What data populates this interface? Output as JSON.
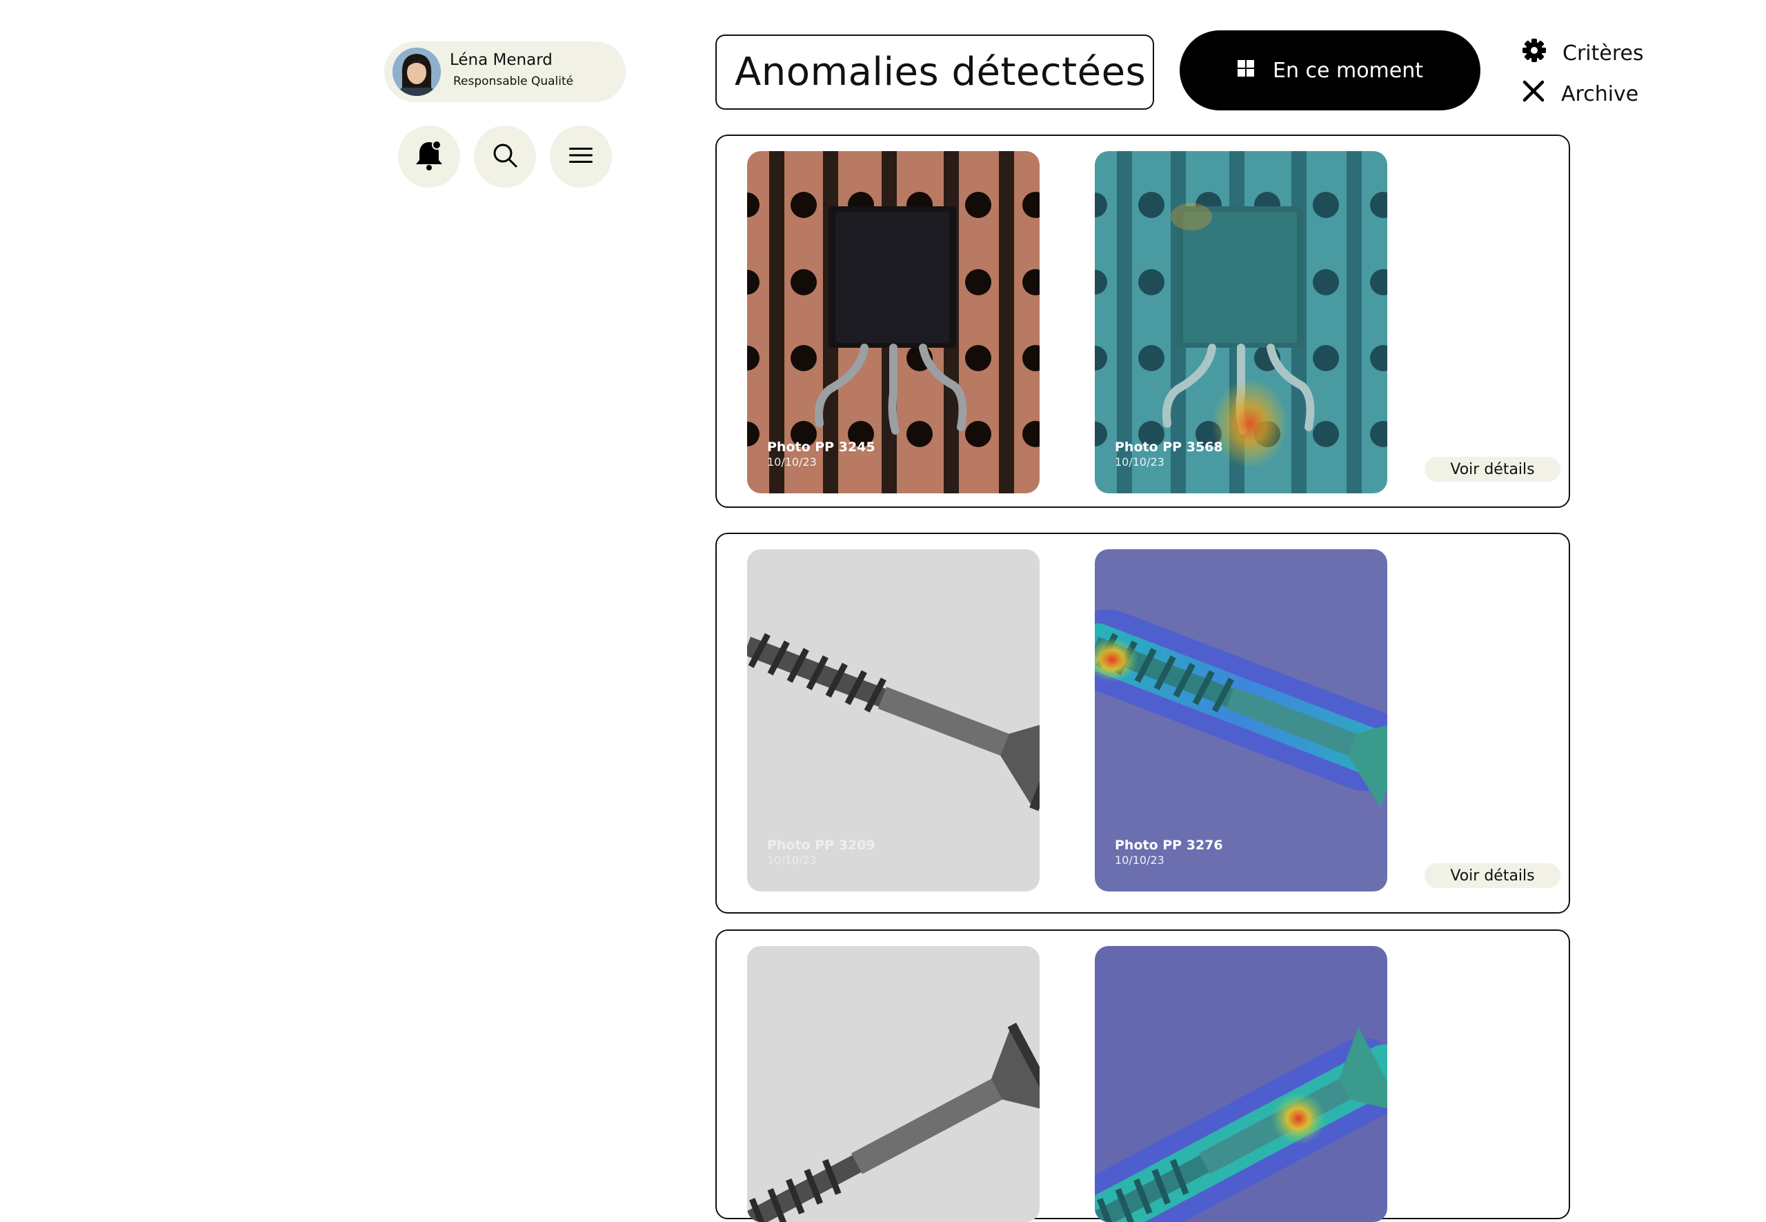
{
  "user": {
    "name": "Léna Menard",
    "role": "Responsable Qualité"
  },
  "toolbar": {
    "notifications_icon": "bell-icon",
    "search_icon": "search-icon",
    "menu_icon": "hamburger-menu-icon"
  },
  "header": {
    "title": "Anomalies détectées",
    "now_button": "En ce moment",
    "now_icon": "grid-icon"
  },
  "side_links": [
    {
      "label": "Critères",
      "icon": "gear-icon"
    },
    {
      "label": "Archive",
      "icon": "close-icon"
    }
  ],
  "cards": [
    {
      "original": {
        "name": "Photo PP 3245",
        "date": "10/10/23"
      },
      "heatmap": {
        "name": "Photo PP 3568",
        "date": "10/10/23"
      },
      "details": "Voir détails"
    },
    {
      "original": {
        "name": "Photo PP 3209",
        "date": "10/10/23"
      },
      "heatmap": {
        "name": "Photo PP 3276",
        "date": "10/10/23"
      },
      "details": "Voir détails"
    },
    {
      "original": {
        "name": "",
        "date": ""
      },
      "heatmap": {
        "name": "",
        "date": ""
      },
      "details": ""
    }
  ],
  "colors": {
    "chip_bg": "#f1f1e6",
    "primary_button": "#000000",
    "heatmap_teal": "#3a8e94",
    "heatmap_blue": "#6b6fb0"
  }
}
